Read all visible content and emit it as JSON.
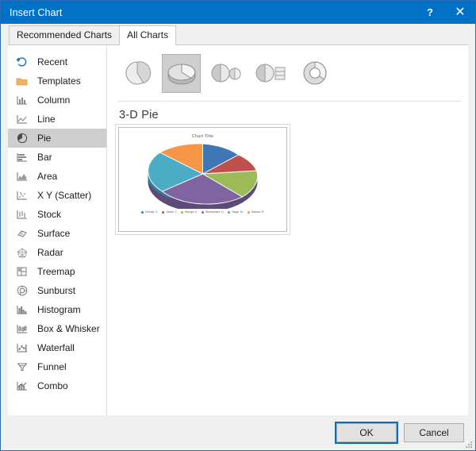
{
  "window": {
    "title": "Insert Chart",
    "help_label": "?",
    "close_label": "✕",
    "titlebar_color": "#0072c6",
    "border_color": "#2b6bb5"
  },
  "tabs": [
    {
      "label": "Recommended Charts",
      "active": false,
      "name": "tab-recommended-charts"
    },
    {
      "label": "All Charts",
      "active": true,
      "name": "tab-all-charts"
    }
  ],
  "sidebar": {
    "items": [
      {
        "label": "Recent",
        "icon": "recent-icon",
        "selected": false
      },
      {
        "label": "Templates",
        "icon": "templates-icon",
        "selected": false
      },
      {
        "label": "Column",
        "icon": "column-chart-icon",
        "selected": false
      },
      {
        "label": "Line",
        "icon": "line-chart-icon",
        "selected": false
      },
      {
        "label": "Pie",
        "icon": "pie-chart-icon",
        "selected": true
      },
      {
        "label": "Bar",
        "icon": "bar-chart-icon",
        "selected": false
      },
      {
        "label": "Area",
        "icon": "area-chart-icon",
        "selected": false
      },
      {
        "label": "X Y (Scatter)",
        "icon": "scatter-chart-icon",
        "selected": false
      },
      {
        "label": "Stock",
        "icon": "stock-chart-icon",
        "selected": false
      },
      {
        "label": "Surface",
        "icon": "surface-chart-icon",
        "selected": false
      },
      {
        "label": "Radar",
        "icon": "radar-chart-icon",
        "selected": false
      },
      {
        "label": "Treemap",
        "icon": "treemap-icon",
        "selected": false
      },
      {
        "label": "Sunburst",
        "icon": "sunburst-icon",
        "selected": false
      },
      {
        "label": "Histogram",
        "icon": "histogram-icon",
        "selected": false
      },
      {
        "label": "Box & Whisker",
        "icon": "box-whisker-icon",
        "selected": false
      },
      {
        "label": "Waterfall",
        "icon": "waterfall-icon",
        "selected": false
      },
      {
        "label": "Funnel",
        "icon": "funnel-icon",
        "selected": false
      },
      {
        "label": "Combo",
        "icon": "combo-chart-icon",
        "selected": false
      }
    ]
  },
  "chart_subtypes": [
    {
      "name": "pie-2d-thumbnail",
      "label": "Pie",
      "selected": false
    },
    {
      "name": "pie-3d-thumbnail",
      "label": "3-D Pie",
      "selected": true
    },
    {
      "name": "pie-of-pie-thumbnail",
      "label": "Pie of Pie",
      "selected": false
    },
    {
      "name": "bar-of-pie-thumbnail",
      "label": "Bar of Pie",
      "selected": false
    },
    {
      "name": "doughnut-thumbnail",
      "label": "Doughnut",
      "selected": false
    }
  ],
  "preview": {
    "heading": "3-D Pie",
    "chart_title": "Chart Title"
  },
  "chart_data": {
    "type": "pie",
    "title": "Chart Title",
    "legend_position": "bottom",
    "categories": [
      "Christie, S.",
      "Tarder, T.",
      "Baroga, K.",
      "Mohammed, D.",
      "Singh, M.",
      "Dadrea, R."
    ],
    "values": [
      14,
      13,
      15,
      24,
      19,
      15
    ],
    "colors": [
      "#3f76b5",
      "#c0504d",
      "#9bbb59",
      "#8064a2",
      "#4bacc6",
      "#f79646"
    ],
    "side_colors": [
      "#2e5a8c",
      "#93403e",
      "#768f44",
      "#5e4a79",
      "#3a8499",
      "#c07435"
    ],
    "three_d": true,
    "xlabel": "",
    "ylabel": ""
  },
  "footer": {
    "ok_label": "OK",
    "cancel_label": "Cancel"
  }
}
